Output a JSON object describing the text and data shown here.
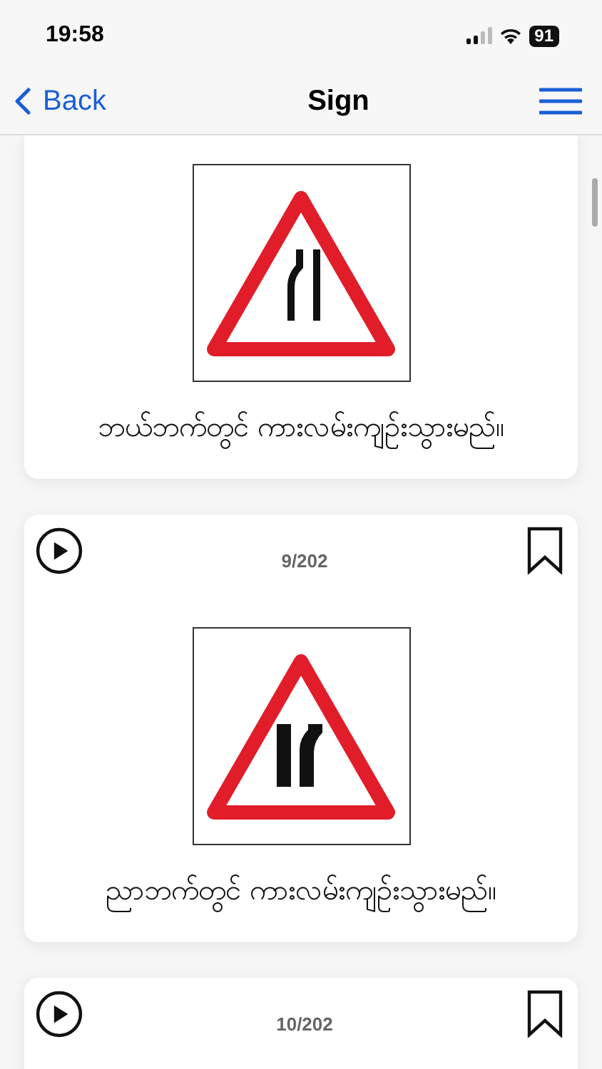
{
  "status_bar": {
    "time": "19:58",
    "battery": "91"
  },
  "nav": {
    "back": "Back",
    "title": "Sign"
  },
  "cards": [
    {
      "sign": {
        "kind": "narrow-left"
      },
      "caption": "ဘယ်ဘက်တွင် ကားလမ်းကျဉ်းသွားမည်။"
    },
    {
      "counter": "9/202",
      "bookmarked": false,
      "sign": {
        "kind": "narrow-right"
      },
      "caption": "ညာဘက်တွင် ကားလမ်းကျဉ်းသွားမည်။"
    },
    {
      "counter": "10/202",
      "bookmarked": false
    }
  ]
}
